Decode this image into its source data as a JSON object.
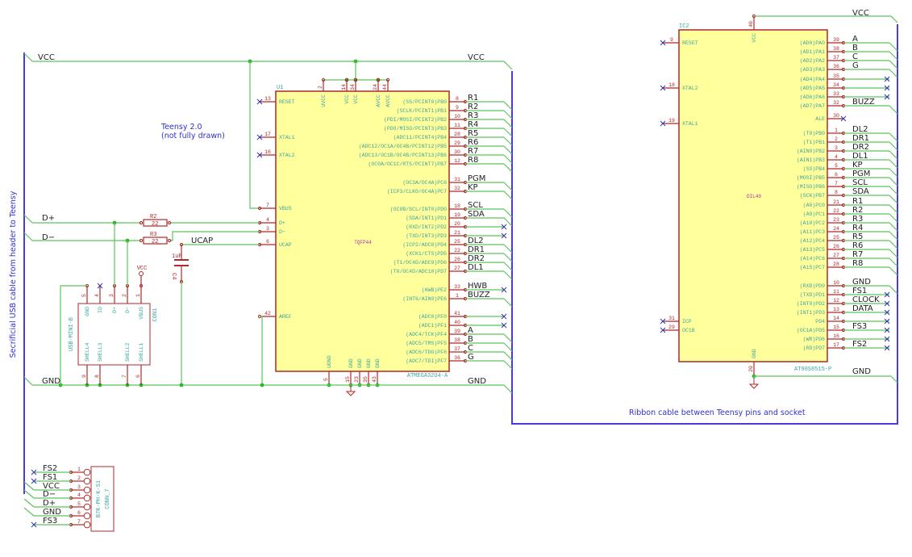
{
  "colors": {
    "wire": "#5cc45c",
    "bus": "#4a3ad8",
    "pin": "#b02828",
    "body_fill": "#ffff9c",
    "body_stroke": "#b02828",
    "pin_name": "#3aa6a0",
    "note": "#3030d0",
    "noconnect": "#3030b0"
  },
  "notes": {
    "teensy_line1": "Teensy 2.0",
    "teensy_line2": "(not fully drawn)",
    "left_bus": "Secrificial USB cable from header to Teensy",
    "right_bus": "Ribbon cable between Teensy pins and socket"
  },
  "nets": {
    "vcc": "VCC",
    "gnd": "GND",
    "dplus": "D+",
    "dminus": "D−",
    "ucap": "UCAP"
  },
  "u1": {
    "ref": "U1",
    "value": "ATMEGA32U4-A",
    "footprint": "TQFP44",
    "left_pins": [
      {
        "num": "13",
        "name": "RESET",
        "nc": true
      },
      {
        "num": "17",
        "name": "XTAL1",
        "nc": true
      },
      {
        "num": "16",
        "name": "XTAL2",
        "nc": true
      },
      {
        "num": "7",
        "name": "VBUS",
        "nc": false
      },
      {
        "num": "4",
        "name": "D+",
        "nc": false
      },
      {
        "num": "3",
        "name": "D−",
        "nc": false
      },
      {
        "num": "6",
        "name": "UCAP",
        "nc": false
      },
      {
        "num": "42",
        "name": "AREF",
        "nc": false
      }
    ],
    "top_pins": [
      {
        "num": "2",
        "name": "UVCC"
      },
      {
        "num": "14",
        "name": "VCC"
      },
      {
        "num": "34",
        "name": "VCC"
      },
      {
        "num": "24",
        "name": "AVCC"
      },
      {
        "num": "44",
        "name": "AVCC"
      }
    ],
    "bottom_pins": [
      {
        "num": "5",
        "name": "UGND"
      },
      {
        "num": "15",
        "name": "GND"
      },
      {
        "num": "23",
        "name": "GND"
      },
      {
        "num": "35",
        "name": "GND"
      },
      {
        "num": "43",
        "name": "GND"
      }
    ],
    "right_pins": [
      {
        "num": "8",
        "name": "(SS/PCINT0)PB0",
        "net": "R1",
        "to_bus": true
      },
      {
        "num": "9",
        "name": "(SCLK/PCINT1)PB1",
        "net": "R2",
        "to_bus": true
      },
      {
        "num": "10",
        "name": "(PDI/MOSI/PCINT2)PB2",
        "net": "R3",
        "to_bus": true
      },
      {
        "num": "11",
        "name": "(PDO/MISO/PCINT3)PB3",
        "net": "R4",
        "to_bus": true
      },
      {
        "num": "28",
        "name": "(ADC11/PCINT4)PB4",
        "net": "R5",
        "to_bus": true
      },
      {
        "num": "29",
        "name": "(ADC12/OC1A/OC4B/PCINT12)PB5",
        "net": "R6",
        "to_bus": true
      },
      {
        "num": "30",
        "name": "(ADC13/OC1B/OC4B/PCINT13)PB6",
        "net": "R7",
        "to_bus": true
      },
      {
        "num": "12",
        "name": "(OC0A/OC1C/RTS/PCINT7)PB7",
        "net": "R8",
        "to_bus": true
      },
      {
        "num": "31",
        "name": "(OC3A/OC4A)PC6",
        "net": "PGM",
        "to_bus": true
      },
      {
        "num": "32",
        "name": "(ICP3/CLK0/OC4A)PC7",
        "net": "KP",
        "to_bus": true
      },
      {
        "num": "18",
        "name": "(OC0B/SCL/INT0)PD0",
        "net": "SCL",
        "to_bus": true
      },
      {
        "num": "19",
        "name": "(SDA/INT1)PD1",
        "net": "SDA",
        "to_bus": true
      },
      {
        "num": "20",
        "name": "(RXD/INT2)PD2",
        "net": "",
        "to_bus": false
      },
      {
        "num": "21",
        "name": "(TXD/INT3)PD3",
        "net": "",
        "to_bus": false
      },
      {
        "num": "25",
        "name": "(ICP2/ADC8)PD4",
        "net": "DL2",
        "to_bus": true
      },
      {
        "num": "22",
        "name": "(XCK1/CTS)PD5",
        "net": "DR1",
        "to_bus": true
      },
      {
        "num": "26",
        "name": "(T1/OC4D/ADC9)PD6",
        "net": "DR2",
        "to_bus": true
      },
      {
        "num": "27",
        "name": "(T0/OC4D/ADC10)PD7",
        "net": "DL1",
        "to_bus": true
      },
      {
        "num": "33",
        "name": "(HWB)PE2",
        "net": "HWB",
        "to_bus": false
      },
      {
        "num": "1",
        "name": "(INT6/AIN0)PE6",
        "net": "BUZZ",
        "to_bus": true
      },
      {
        "num": "41",
        "name": "(ADC0)PF0",
        "net": "",
        "to_bus": false
      },
      {
        "num": "40",
        "name": "(ADC1)PF1",
        "net": "",
        "to_bus": false
      },
      {
        "num": "39",
        "name": "(ADC4/TCK)PF4",
        "net": "A",
        "to_bus": true
      },
      {
        "num": "38",
        "name": "(ADC5/TMS)PF5",
        "net": "B",
        "to_bus": true
      },
      {
        "num": "37",
        "name": "(ADC6/TDO)PF6",
        "net": "C",
        "to_bus": true
      },
      {
        "num": "36",
        "name": "(ADC7/TDI)PF7",
        "net": "G",
        "to_bus": true
      }
    ]
  },
  "ic2": {
    "ref": "IC2",
    "value": "AT90S8515-P",
    "footprint": "DIL40",
    "top_pin": {
      "num": "40",
      "name": "VCC"
    },
    "bottom_pin": {
      "num": "20",
      "name": "GND"
    },
    "left_pins": [
      {
        "num": "9",
        "name": "RESET"
      },
      {
        "num": "18",
        "name": "XTAL2"
      },
      {
        "num": "19",
        "name": "XTAL1"
      },
      {
        "num": "31",
        "name": "ICP"
      },
      {
        "num": "29",
        "name": "OC1B"
      }
    ],
    "right_pins": [
      {
        "num": "39",
        "name": "(AD0)PA0",
        "net": "A",
        "to_bus": true
      },
      {
        "num": "38",
        "name": "(AD1)PA1",
        "net": "B",
        "to_bus": true
      },
      {
        "num": "37",
        "name": "(AD2)PA2",
        "net": "C",
        "to_bus": true
      },
      {
        "num": "36",
        "name": "(AD3)PA3",
        "net": "G",
        "to_bus": true
      },
      {
        "num": "35",
        "name": "(AD4)PA4",
        "net": "",
        "to_bus": false
      },
      {
        "num": "34",
        "name": "(AD5)PA5",
        "net": "",
        "to_bus": false
      },
      {
        "num": "33",
        "name": "(AD6)PA6",
        "net": "",
        "to_bus": false
      },
      {
        "num": "32",
        "name": "(AD7)PA7",
        "net": "BUZZ",
        "to_bus": true
      },
      {
        "num": "30",
        "name": "ALE",
        "net": "",
        "to_bus": false,
        "short": true
      },
      {
        "num": "1",
        "name": "(T0)PB0",
        "net": "DL2",
        "to_bus": true
      },
      {
        "num": "2",
        "name": "(T1)PB1",
        "net": "DR1",
        "to_bus": true
      },
      {
        "num": "3",
        "name": "(AIN0)PB2",
        "net": "DR2",
        "to_bus": true
      },
      {
        "num": "4",
        "name": "(AIN1)PB3",
        "net": "DL1",
        "to_bus": true
      },
      {
        "num": "5",
        "name": "(SS)PB4",
        "net": "KP",
        "to_bus": true
      },
      {
        "num": "6",
        "name": "(MOSI)PB5",
        "net": "PGM",
        "to_bus": true
      },
      {
        "num": "7",
        "name": "(MISO)PB6",
        "net": "SCL",
        "to_bus": true
      },
      {
        "num": "8",
        "name": "(SCK)PB7",
        "net": "SDA",
        "to_bus": true
      },
      {
        "num": "21",
        "name": "(A8)PC0",
        "net": "R1",
        "to_bus": true
      },
      {
        "num": "22",
        "name": "(A9)PC1",
        "net": "R2",
        "to_bus": true
      },
      {
        "num": "23",
        "name": "(A10)PC2",
        "net": "R3",
        "to_bus": true
      },
      {
        "num": "24",
        "name": "(A11)PC3",
        "net": "R4",
        "to_bus": true
      },
      {
        "num": "25",
        "name": "(A12)PC4",
        "net": "R5",
        "to_bus": true
      },
      {
        "num": "26",
        "name": "(A13)PC5",
        "net": "R6",
        "to_bus": true
      },
      {
        "num": "27",
        "name": "(A14)PC6",
        "net": "R7",
        "to_bus": true
      },
      {
        "num": "28",
        "name": "(A15)PC7",
        "net": "R8",
        "to_bus": true
      },
      {
        "num": "10",
        "name": "(RXD)PD0",
        "net": "GND",
        "to_bus": true
      },
      {
        "num": "11",
        "name": "(TXD)PD1",
        "net": "FS1",
        "to_bus": false
      },
      {
        "num": "12",
        "name": "(INT0)PD2",
        "net": "CLOCK",
        "to_bus": false
      },
      {
        "num": "13",
        "name": "(INT1)PD3",
        "net": "DATA",
        "to_bus": false
      },
      {
        "num": "14",
        "name": "PD4",
        "net": "",
        "to_bus": false
      },
      {
        "num": "15",
        "name": "(OC1A)PD5",
        "net": "FS3",
        "to_bus": false
      },
      {
        "num": "16",
        "name": "(WR)PD6",
        "net": "",
        "to_bus": false
      },
      {
        "num": "17",
        "name": "(RD)PD7",
        "net": "FS2",
        "to_bus": false
      }
    ]
  },
  "con1": {
    "ref": "CON1",
    "value": "USB-MINI-B",
    "vbus_symbol": "VCC",
    "top_pins": [
      {
        "num": "5",
        "name": "GND"
      },
      {
        "num": "4",
        "name": "ID"
      },
      {
        "num": "3",
        "name": "D+"
      },
      {
        "num": "2",
        "name": "D−"
      },
      {
        "num": "1",
        "name": "VBUS"
      }
    ],
    "bottom_pins": [
      {
        "num": "9",
        "name": "SHELL4"
      },
      {
        "num": "8",
        "name": "SHELL3"
      },
      {
        "num": "7",
        "name": "SHELL2"
      },
      {
        "num": "6",
        "name": "SHELL1"
      }
    ]
  },
  "r2": {
    "ref": "R2",
    "value": "22"
  },
  "r3": {
    "ref": "R3",
    "value": "22"
  },
  "c4": {
    "ref": "C4",
    "value": "1uF"
  },
  "conn7": {
    "ref": "CONN_7",
    "value": "B7K-PH-K-S1",
    "pins": [
      {
        "num": "1",
        "net": "FS2",
        "to_bus": false
      },
      {
        "num": "2",
        "net": "FS1",
        "to_bus": false
      },
      {
        "num": "3",
        "net": "VCC",
        "to_bus": true
      },
      {
        "num": "4",
        "net": "D−",
        "to_bus": true
      },
      {
        "num": "5",
        "net": "D+",
        "to_bus": true
      },
      {
        "num": "6",
        "net": "GND",
        "to_bus": true
      },
      {
        "num": "7",
        "net": "FS3",
        "to_bus": false
      }
    ]
  }
}
